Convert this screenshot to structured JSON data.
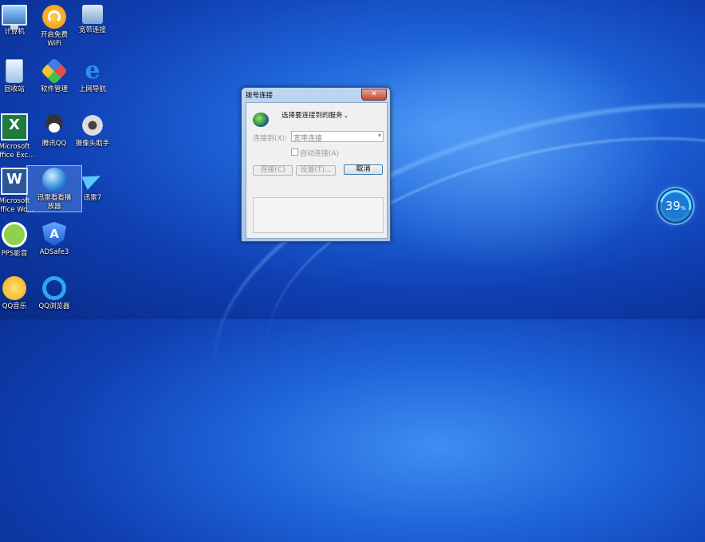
{
  "desktop": {
    "icons": [
      {
        "label": "计算机"
      },
      {
        "label": "开启免费\nWiFi"
      },
      {
        "label": "宽带连接"
      },
      {
        "label": "回收站"
      },
      {
        "label": "软件管理"
      },
      {
        "label": "上网导航"
      },
      {
        "label": "Microsoft\nOffice Exc..."
      },
      {
        "label": "腾讯QQ"
      },
      {
        "label": "摄像头助手"
      },
      {
        "label": "Microsoft\nOffice Wo..."
      },
      {
        "label": "迅雷看看播\n放器"
      },
      {
        "label": "迅雷7"
      },
      {
        "label": "PPS影音"
      },
      {
        "label": "ADSafe3"
      },
      {
        "label": "QQ音乐"
      },
      {
        "label": "QQ浏览器"
      }
    ],
    "icon_glyph_text": {
      "excel": "X",
      "word": "W",
      "ie": "e",
      "adsafe": "A"
    }
  },
  "dialog": {
    "title": "拨号连接",
    "close_glyph": "✕",
    "heading": "选择要连接到的服务 。",
    "connect_to_label": "连接到(X):",
    "connect_to_value": "宽带连接",
    "auto_connect_label": "自动连接(A)",
    "auto_connect_checked": false,
    "connect_button": "连接(C)",
    "settings_button": "设置(T)...",
    "cancel_button": "取消"
  },
  "gauge": {
    "value": "39",
    "unit": "%"
  }
}
